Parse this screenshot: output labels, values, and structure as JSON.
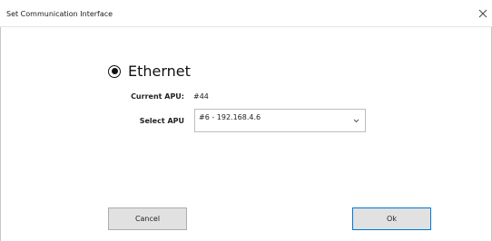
{
  "window": {
    "title": "Set Communication Interface",
    "close_icon": "close-icon"
  },
  "interface": {
    "option_label": "Ethernet",
    "selected": true
  },
  "current_apu": {
    "label": "Current APU:",
    "value": "#44"
  },
  "select_apu": {
    "label": "Select APU",
    "selected_value": "#6 - 192.168.4.6",
    "icon": "chevron-down-icon"
  },
  "buttons": {
    "cancel": "Cancel",
    "ok": "Ok"
  }
}
